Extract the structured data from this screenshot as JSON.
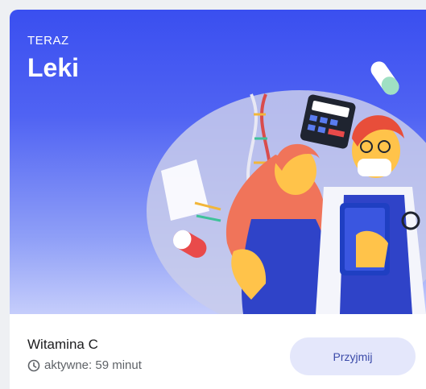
{
  "hero": {
    "eyebrow": "TERAZ",
    "title": "Leki"
  },
  "medication": {
    "name": "Witamina C",
    "status": "aktywne: 59 minut",
    "action_label": "Przyjmij"
  },
  "icons": {
    "status": "clock-icon"
  },
  "colors": {
    "hero_blue": "#3a4ff0",
    "button_bg": "#e4e7fb",
    "button_text": "#3a4aa8"
  }
}
